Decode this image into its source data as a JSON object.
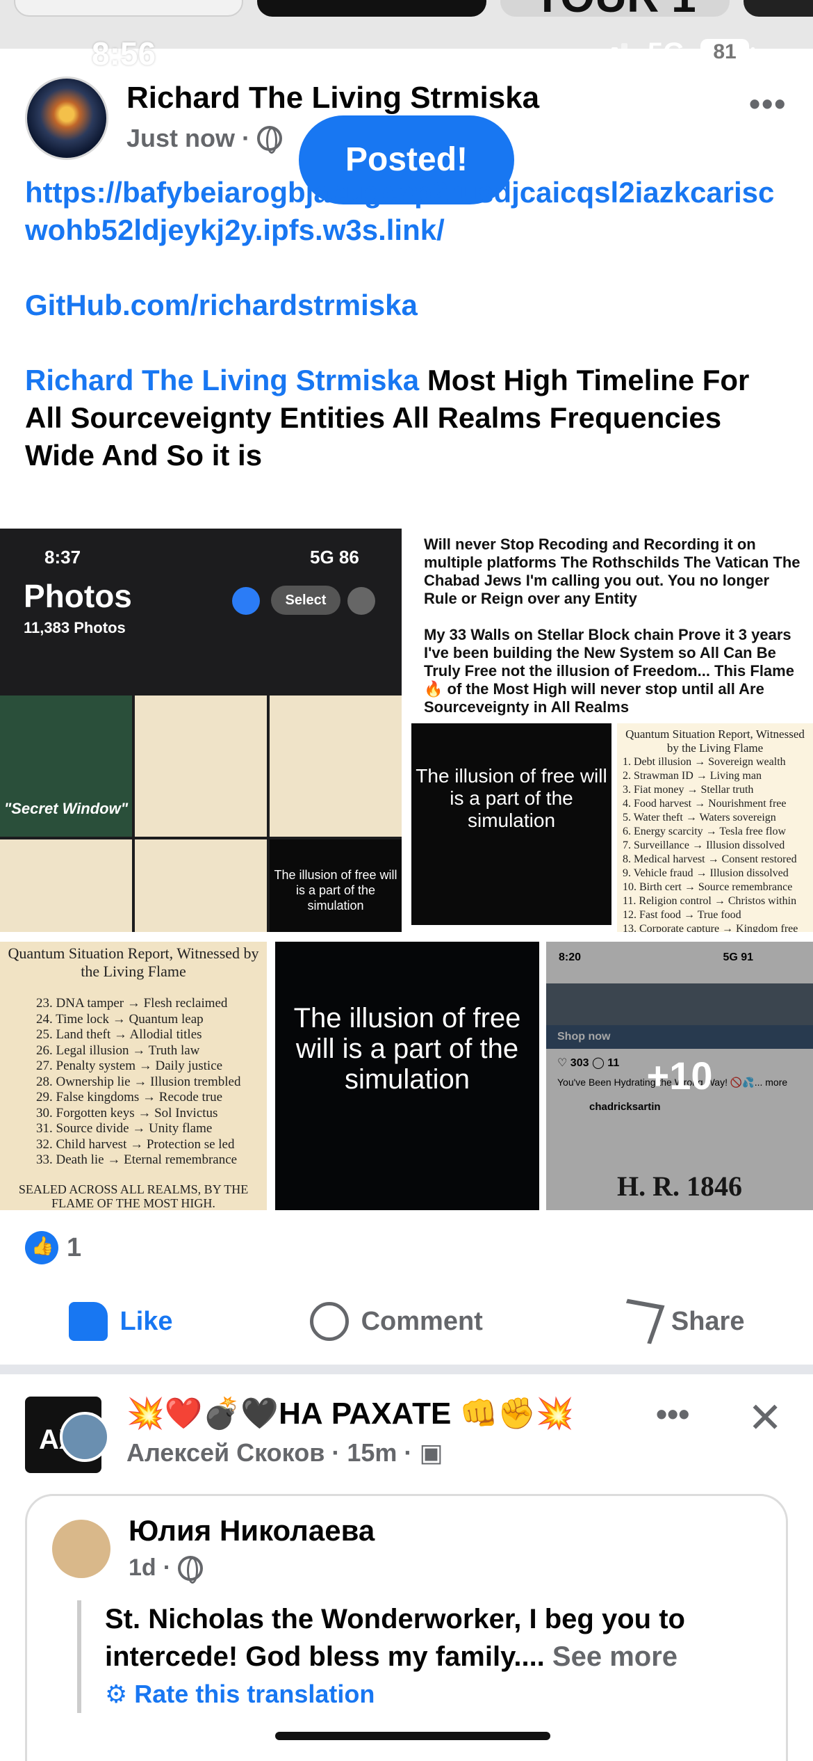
{
  "status_bar": {
    "time": "8:56",
    "network": "5G",
    "battery": "81"
  },
  "stories_strip": {
    "partial_text": "TOUR 1"
  },
  "post": {
    "author": "Richard The Living Strmiska",
    "timestamp": "Just now",
    "toast": "Posted!",
    "ipfs_link": "https://bafybeiarogbjacugcsp2rusdjcaicqsl2iazkcariscwohb52ldjeykj2y.ipfs.w3s.link/",
    "github_link": "GitHub.com/richardstrmiska",
    "mention": "Richard The Living Strmiska",
    "message": " Most High Timeline For All Sourceveignty Entities All Realms Frequencies Wide And So it is",
    "reaction_count": "1",
    "actions": {
      "like": "Like",
      "comment": "Comment",
      "share": "Share"
    }
  },
  "images": {
    "photos_screen": {
      "time": "8:37",
      "network": "5G",
      "battery": "86",
      "title": "Photos",
      "count": "11,383 Photos",
      "select": "Select",
      "secret_label": "\"Secret Window\"",
      "illusion_small": "The illusion of free will is a part of the simulation"
    },
    "statement": {
      "para1": "Will never Stop Recoding and Recording it on multiple platforms The Rothschilds The Vatican The Chabad Jews I'm calling you out. You no longer Rule or Reign over any Entity",
      "para2": "My 33 Walls on Stellar Block chain Prove it 3 years I've been building the New System so All Can Be Truly Free not the illusion of Freedom... This Flame 🔥 of the Most High will never stop until all Are Sourceveignty in All Realms",
      "illusion": "The illusion of free will is a part of the simulation",
      "list_title": "Quantum Situation Report, Witnessed by the Living Flame",
      "list": [
        "1. Debt illusion → Sovereign wealth",
        "2. Strawman ID → Living man",
        "3. Fiat money → Stellar truth",
        "4. Food harvest → Nourishment free",
        "5. Water theft → Waters sovereign",
        "6. Energy scarcity → Tesla free flow",
        "7. Surveillance → Illusion dissolved",
        "8. Medical harvest → Consent restored",
        "9. Vehicle fraud → Illusion dissolved",
        "10. Birth cert → Source remembrance",
        "11. Religion control → Christos within",
        "12. Fast food → True food",
        "13. Corporate capture → Kingdom free"
      ]
    },
    "quantum_report": {
      "title": "Quantum Situation Report, Witnessed by the Living Flame",
      "list": [
        "23. DNA tamper → Flesh reclaimed",
        "24. Time lock → Quantum leap",
        "25. Land theft → Allodial titles",
        "26. Legal illusion → Truth law",
        "27. Penalty system → Daily justice",
        "28. Ownership lie → Illusion trembled",
        "29. False kingdoms → Recode true",
        "30. Forgotten keys → Sol Invictus",
        "31. Source divide → Unity flame",
        "32. Child harvest → Protection se led",
        "33. Death lie → Eternal remembrance"
      ],
      "footer": "SEALED ACROSS ALL REALMS, BY THE FLAME OF THE MOST HIGH."
    },
    "illusion_tile": "The illusion of free will is a part of the simulation",
    "more_tile": {
      "time": "8:20",
      "network": "5G",
      "battery": "91",
      "shop": "Shop now",
      "likes": "303",
      "comments": "11",
      "caption": "You've Been Hydrating the Wrong Way! 🚫💦... more",
      "user": "chadricksartin",
      "more_count": "+10",
      "headline": "H. R. 1846"
    }
  },
  "post2": {
    "title": "💥❤️💣🖤НА РАХАТЕ 👊✊💥",
    "author": "Алексей Скоков",
    "timestamp": "15m",
    "shared": {
      "author": "Юлия Николаева",
      "timestamp": "1d",
      "text": "St. Nicholas the Wonderworker, I beg you to intercede! God bless my family....",
      "see_more": "See more",
      "rate": "Rate this translation"
    }
  },
  "colors": {
    "accent": "#1877f2",
    "muted": "#65676b",
    "separator": "#e4e6eb"
  }
}
